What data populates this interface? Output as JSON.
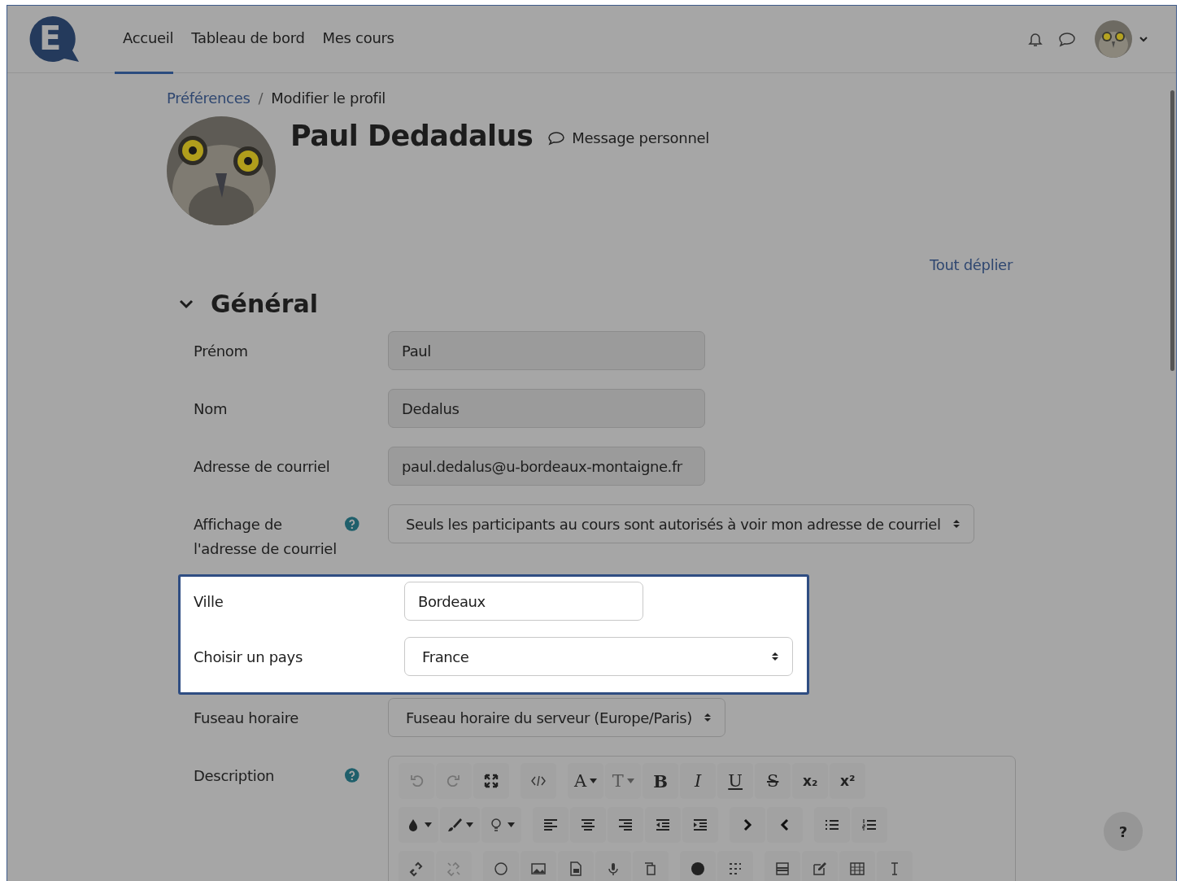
{
  "navbar": {
    "logo_letter": "E",
    "items": [
      {
        "label": "Accueil",
        "selected": true
      },
      {
        "label": "Tableau de bord",
        "selected": false
      },
      {
        "label": "Mes cours",
        "selected": false
      }
    ]
  },
  "breadcrumb": {
    "separator": "/",
    "items": [
      {
        "label": "Préférences",
        "kind": "link"
      },
      {
        "label": "Modifier le profil",
        "kind": "current"
      }
    ]
  },
  "profile": {
    "name": "Paul Dedadalus",
    "message_link": "Message personnel"
  },
  "expand_all": "Tout déplier",
  "section": {
    "title": "Général",
    "expanded": true,
    "fields": [
      {
        "label": "Prénom",
        "kind": "text",
        "value": "Paul",
        "disabled": true,
        "help": false,
        "highlighted": false
      },
      {
        "label": "Nom",
        "kind": "text",
        "value": "Dedalus",
        "disabled": true,
        "help": false,
        "highlighted": false
      },
      {
        "label": "Adresse de courriel",
        "kind": "text",
        "value": "paul.dedalus@u-bordeaux-montaigne.fr",
        "disabled": true,
        "help": false,
        "highlighted": false
      },
      {
        "label": "Affichage de l'adresse de courriel",
        "kind": "select",
        "value": "Seuls les participants au cours sont autorisés à voir mon adresse de courriel",
        "disabled": false,
        "help": true,
        "highlighted": false
      },
      {
        "label": "Ville",
        "kind": "text",
        "value": "Bordeaux",
        "disabled": false,
        "help": false,
        "highlighted": true
      },
      {
        "label": "Choisir un pays",
        "kind": "select",
        "value": "France",
        "disabled": false,
        "help": false,
        "highlighted": true
      },
      {
        "label": "Fuseau horaire",
        "kind": "select",
        "value": "Fuseau horaire du serveur (Europe/Paris)",
        "disabled": false,
        "help": false,
        "highlighted": false
      },
      {
        "label": "Description",
        "kind": "editor",
        "help": true,
        "disabled": false,
        "highlighted": false,
        "toolbar": [
          [
            [
              {
                "kind": "icon",
                "disabled": true,
                "dropdown": false
              },
              {
                "kind": "icon",
                "disabled": true,
                "dropdown": false
              },
              {
                "kind": "icon",
                "disabled": false,
                "dropdown": false
              }
            ],
            [
              {
                "kind": "icon",
                "disabled": false,
                "dropdown": false
              }
            ],
            [
              {
                "kind": "glyph",
                "glyph": "A",
                "dropdown": true,
                "disabled": false
              },
              {
                "kind": "glyph",
                "glyph": "T",
                "dropdown": true,
                "disabled": true
              },
              {
                "kind": "glyph",
                "glyph": "B",
                "dropdown": false,
                "disabled": false
              },
              {
                "kind": "glyph",
                "glyph": "I",
                "dropdown": false,
                "disabled": false
              },
              {
                "kind": "glyph",
                "glyph": "U",
                "dropdown": false,
                "disabled": false
              },
              {
                "kind": "glyph",
                "glyph": "S",
                "dropdown": false,
                "disabled": false
              },
              {
                "kind": "glyph",
                "glyph": "x₂",
                "dropdown": false,
                "disabled": false
              },
              {
                "kind": "glyph",
                "glyph": "x²",
                "dropdown": false,
                "disabled": false
              }
            ]
          ],
          [
            [
              {
                "kind": "icon",
                "dropdown": true,
                "disabled": false
              },
              {
                "kind": "icon",
                "dropdown": true,
                "disabled": false
              },
              {
                "kind": "icon",
                "dropdown": true,
                "disabled": false
              }
            ],
            [
              {
                "kind": "icon",
                "dropdown": false,
                "disabled": false
              },
              {
                "kind": "icon",
                "dropdown": false,
                "disabled": false
              },
              {
                "kind": "icon",
                "dropdown": false,
                "disabled": false
              },
              {
                "kind": "icon",
                "dropdown": false,
                "disabled": false
              },
              {
                "kind": "icon",
                "dropdown": false,
                "disabled": false
              }
            ],
            [
              {
                "kind": "icon",
                "dropdown": false,
                "disabled": false
              },
              {
                "kind": "icon",
                "dropdown": false,
                "disabled": false
              }
            ],
            [
              {
                "kind": "icon",
                "dropdown": false,
                "disabled": false
              },
              {
                "kind": "icon",
                "dropdown": false,
                "disabled": false
              }
            ]
          ],
          [
            [
              {
                "kind": "icon",
                "dropdown": false,
                "disabled": false
              },
              {
                "kind": "icon",
                "dropdown": false,
                "disabled": true
              }
            ],
            [
              {
                "kind": "icon",
                "dropdown": false,
                "disabled": false
              },
              {
                "kind": "icon",
                "dropdown": false,
                "disabled": false
              },
              {
                "kind": "icon",
                "dropdown": false,
                "disabled": false
              },
              {
                "kind": "icon",
                "dropdown": false,
                "disabled": false
              },
              {
                "kind": "icon",
                "dropdown": false,
                "disabled": false
              }
            ],
            [
              {
                "kind": "icon",
                "dropdown": false,
                "disabled": false
              },
              {
                "kind": "icon",
                "dropdown": false,
                "disabled": false
              }
            ],
            [
              {
                "kind": "icon",
                "dropdown": false,
                "disabled": false
              },
              {
                "kind": "icon",
                "dropdown": false,
                "disabled": false
              },
              {
                "kind": "icon",
                "dropdown": false,
                "disabled": false
              },
              {
                "kind": "icon",
                "dropdown": false,
                "disabled": false
              }
            ]
          ]
        ]
      }
    ]
  },
  "help_button": "?"
}
